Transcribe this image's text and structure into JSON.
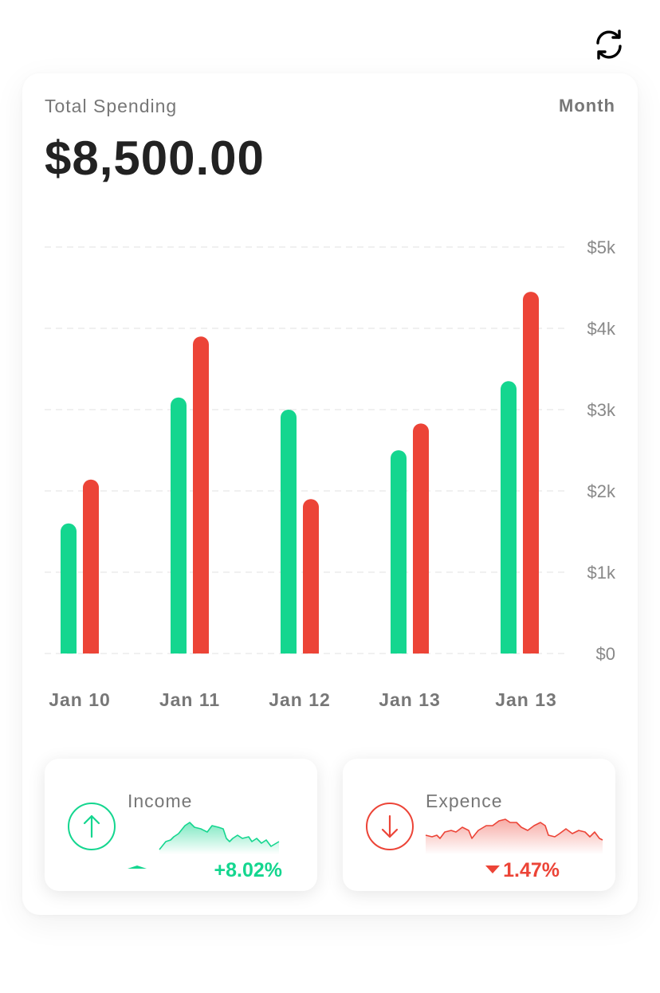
{
  "header": {
    "refresh_icon": "refresh-icon"
  },
  "card": {
    "title": "Total Spending",
    "period": "Month",
    "total": "$8,500.00"
  },
  "colors": {
    "income": "#14d68f",
    "expense": "#ec4437",
    "grid": "#e6e6e6",
    "text_muted": "#777777"
  },
  "chart_data": {
    "type": "bar",
    "categories": [
      "Jan 10",
      "Jan 11",
      "Jan 12",
      "Jan 13",
      "Jan 13"
    ],
    "series": [
      {
        "values": [
          1600,
          3150,
          3000,
          2500,
          3350
        ],
        "color": "#14d68f"
      },
      {
        "values": [
          2140,
          3900,
          1900,
          2830,
          4450
        ],
        "color": "#ec4437"
      }
    ],
    "yticks": [
      "$0",
      "$1k",
      "$2k",
      "$3k",
      "$4k",
      "$5k"
    ],
    "ylim": [
      0,
      5000
    ],
    "grid": true,
    "xlabel": "",
    "ylabel": ""
  },
  "stats": {
    "income": {
      "label": "Income",
      "change": "+8.02%",
      "icon": "arrow-up-circle-icon"
    },
    "expense": {
      "label": "Expence",
      "change": "1.47%",
      "icon": "arrow-down-circle-icon"
    }
  }
}
